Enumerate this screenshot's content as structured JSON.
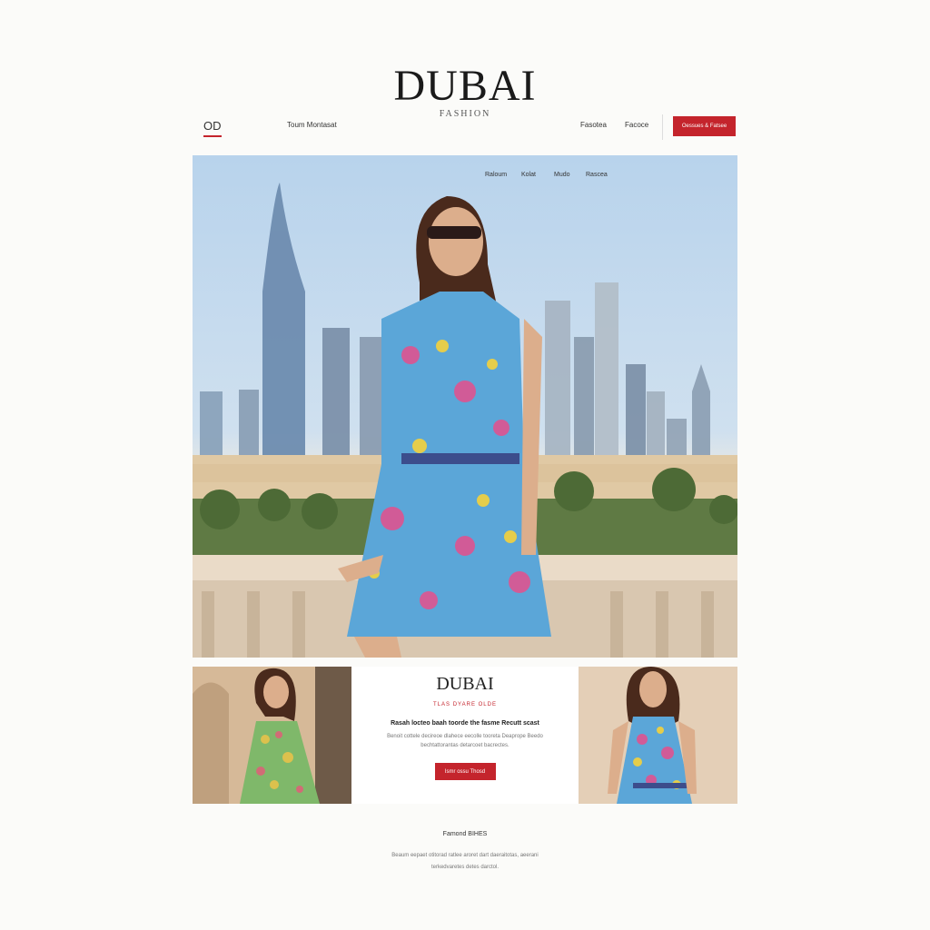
{
  "brand": {
    "title": "DUBAI",
    "subtitle": "FASHION"
  },
  "topbar": {
    "logo": "OD",
    "left_link": "Toum Montasat",
    "right_links": [
      "Fasotea",
      "Facoce"
    ],
    "cta": "Oessues & Fatsee"
  },
  "hero": {
    "nav": [
      "Raloum",
      "Kolat",
      "Mudo",
      "Rascea"
    ]
  },
  "promo": {
    "title": "DUBAI",
    "subtitle": "TLAS DYARE OLDE",
    "heading": "Rasah locteo baah toorde the fasme Recutt scast",
    "body": "Benoit cottele decireoe dlahece eecolle tooreta Deaprope Beedo bechtattorantas detarcoet bacrectes.",
    "button": "Ismr ossu Thosd"
  },
  "footer": {
    "title": "Famond BIHES",
    "body": "Beaum eepaet otitorad ratlee aroret dart daeraitotas, aeerani terkedvaretes detes darctol."
  },
  "colors": {
    "accent": "#c4242c",
    "page": "#fbfbf9"
  }
}
